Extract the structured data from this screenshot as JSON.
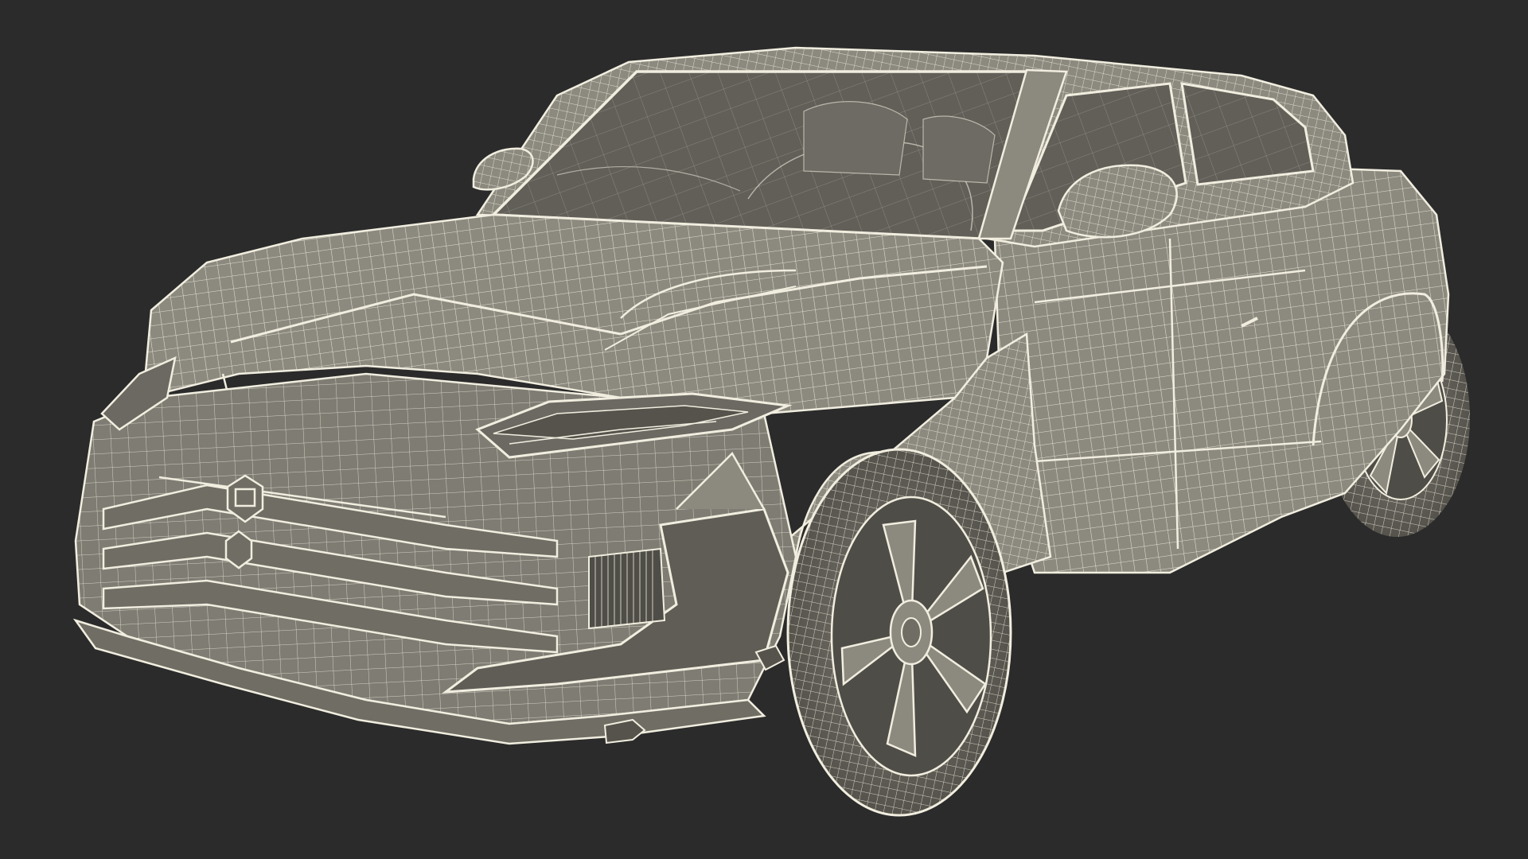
{
  "scene": {
    "background_color": "#2b2b2b",
    "surface_color": "#8c8a7f",
    "surface_shadow_color": "#6f6d64",
    "glass_color": "#615f58",
    "wire_color": "#f1eee0",
    "wheel_dark_color": "#4f4d47"
  }
}
